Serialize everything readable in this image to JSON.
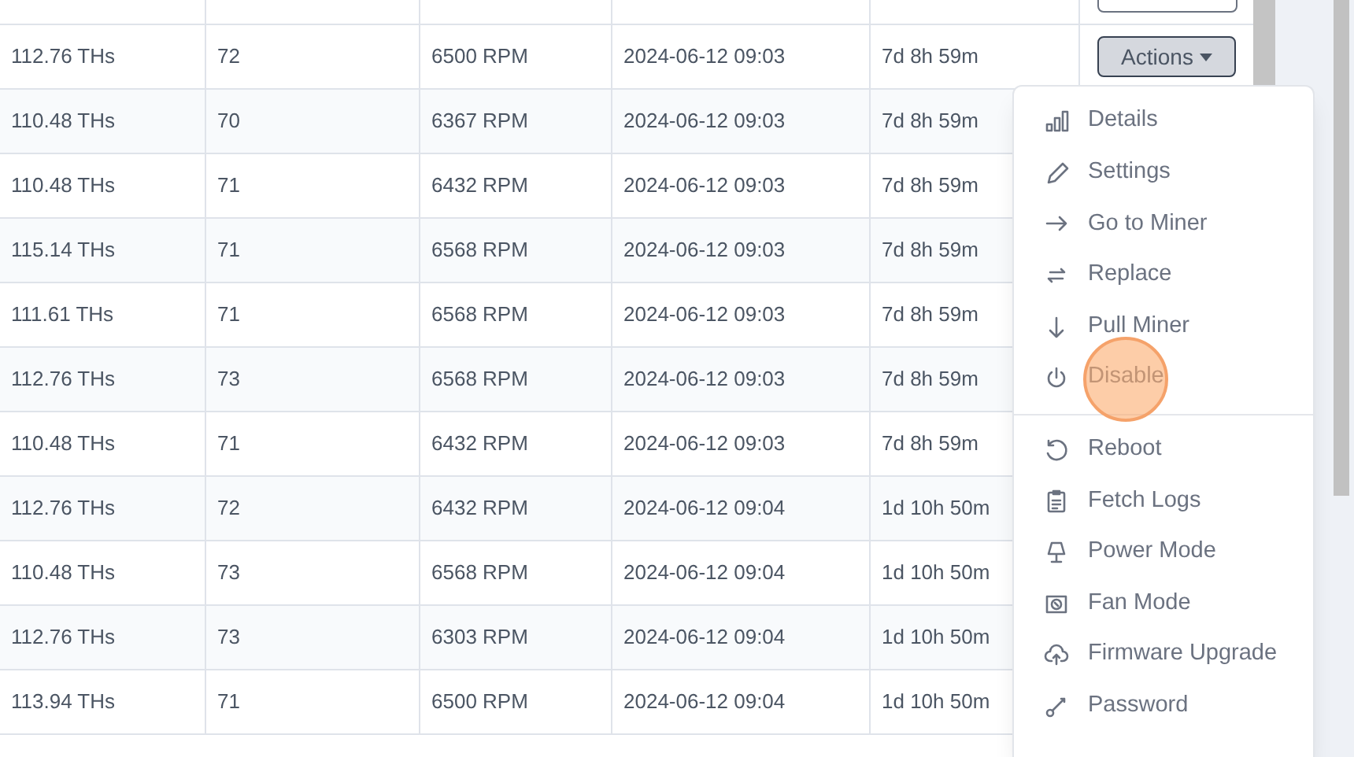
{
  "table": {
    "rows": [
      {
        "hashrate": "112.76 THs",
        "temp": "72",
        "fan": "6500 RPM",
        "updated": "2024-06-12 09:03",
        "uptime": "7d 8h 59m",
        "action": {
          "label": "Actions",
          "expanded": true
        }
      },
      {
        "hashrate": "110.48 THs",
        "temp": "70",
        "fan": "6367 RPM",
        "updated": "2024-06-12 09:03",
        "uptime": "7d 8h 59m"
      },
      {
        "hashrate": "110.48 THs",
        "temp": "71",
        "fan": "6432 RPM",
        "updated": "2024-06-12 09:03",
        "uptime": "7d 8h 59m"
      },
      {
        "hashrate": "115.14 THs",
        "temp": "71",
        "fan": "6568 RPM",
        "updated": "2024-06-12 09:03",
        "uptime": "7d 8h 59m"
      },
      {
        "hashrate": "111.61 THs",
        "temp": "71",
        "fan": "6568 RPM",
        "updated": "2024-06-12 09:03",
        "uptime": "7d 8h 59m"
      },
      {
        "hashrate": "112.76 THs",
        "temp": "73",
        "fan": "6568 RPM",
        "updated": "2024-06-12 09:03",
        "uptime": "7d 8h 59m"
      },
      {
        "hashrate": "110.48 THs",
        "temp": "71",
        "fan": "6432 RPM",
        "updated": "2024-06-12 09:03",
        "uptime": "7d 8h 59m"
      },
      {
        "hashrate": "112.76 THs",
        "temp": "72",
        "fan": "6432 RPM",
        "updated": "2024-06-12 09:04",
        "uptime": "1d 10h 50m"
      },
      {
        "hashrate": "110.48 THs",
        "temp": "73",
        "fan": "6568 RPM",
        "updated": "2024-06-12 09:04",
        "uptime": "1d 10h 50m"
      },
      {
        "hashrate": "112.76 THs",
        "temp": "73",
        "fan": "6303 RPM",
        "updated": "2024-06-12 09:04",
        "uptime": "1d 10h 50m"
      },
      {
        "hashrate": "113.94 THs",
        "temp": "71",
        "fan": "6500 RPM",
        "updated": "2024-06-12 09:04",
        "uptime": "1d 10h 50m"
      }
    ]
  },
  "actions_menu": {
    "groups": [
      {
        "items": [
          {
            "label": "Details",
            "clicked": false
          },
          {
            "label": "Settings",
            "clicked": false
          },
          {
            "label": "Go to Miner",
            "clicked": false
          },
          {
            "label": "Replace",
            "clicked": false
          },
          {
            "label": "Pull Miner",
            "clicked": false
          },
          {
            "label": "Disable",
            "clicked": true
          }
        ]
      },
      {
        "items": [
          {
            "label": "Reboot",
            "clicked": false
          },
          {
            "label": "Fetch Logs",
            "clicked": false
          },
          {
            "label": "Power Mode",
            "clicked": false
          },
          {
            "label": "Fan Mode",
            "clicked": false
          },
          {
            "label": "Firmware Upgrade",
            "clicked": false
          },
          {
            "label": "Password",
            "clicked": false
          }
        ]
      }
    ]
  }
}
